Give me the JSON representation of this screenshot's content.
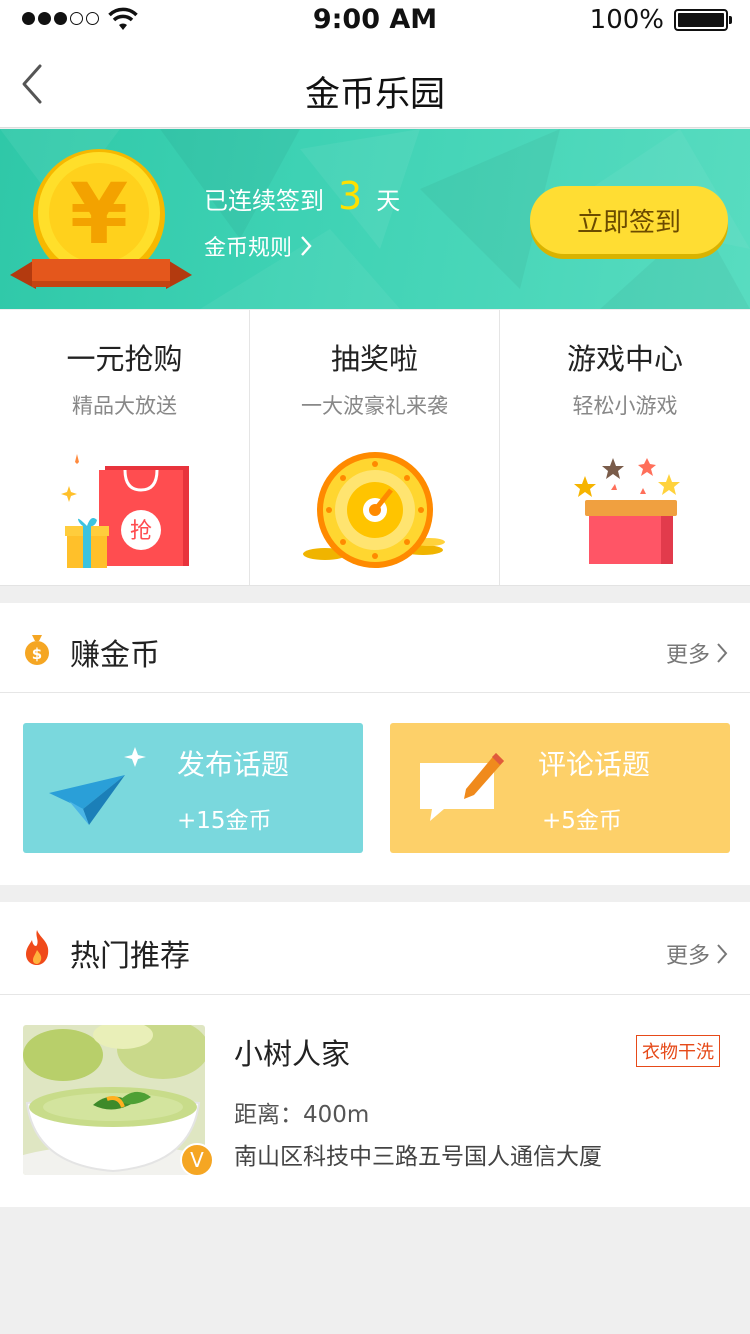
{
  "status": {
    "time": "9:00 AM",
    "battery": "100%"
  },
  "nav": {
    "title": "金币乐园"
  },
  "banner": {
    "prefix": "已连续签到",
    "days": "3",
    "suffix": "天",
    "rules": "金币规则",
    "signin": "立即签到",
    "colors": {
      "bg": "#3ed2b4",
      "button": "#ffdd33",
      "days": "#ffe000"
    }
  },
  "features": [
    {
      "title": "一元抢购",
      "subtitle": "精品大放送",
      "icon": "shopping-bag-icon",
      "badge": "抢"
    },
    {
      "title": "抽奖啦",
      "subtitle": "一大波豪礼来袭",
      "icon": "lottery-wheel-icon"
    },
    {
      "title": "游戏中心",
      "subtitle": "轻松小游戏",
      "icon": "game-box-icon"
    }
  ],
  "earn": {
    "title": "赚金币",
    "more": "更多",
    "cards": [
      {
        "title": "发布话题",
        "reward": "+15金币",
        "icon": "paper-plane-icon",
        "color": "#7ad8dd"
      },
      {
        "title": "评论话题",
        "reward": "+5金币",
        "icon": "comment-edit-icon",
        "color": "#fdd069"
      }
    ]
  },
  "hot": {
    "title": "热门推荐",
    "more": "更多",
    "items": [
      {
        "name": "小树人家",
        "tag": "衣物干洗",
        "distance": "距离：400m",
        "address": "南山区科技中三路五号国人通信大厦",
        "badge": "V"
      }
    ]
  }
}
